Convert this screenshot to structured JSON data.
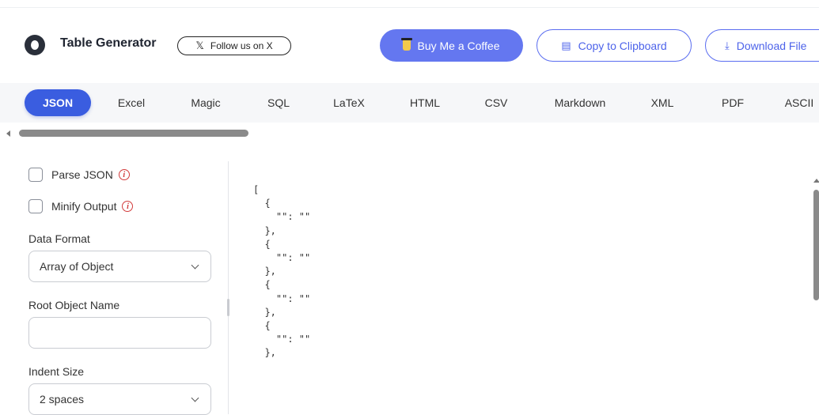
{
  "header": {
    "brand": "Table Generator",
    "follow_label": "Follow us on X",
    "coffee_label": "Buy Me a Coffee",
    "copy_label": "Copy to Clipboard",
    "download_label": "Download File"
  },
  "tabs": [
    {
      "label": "JSON",
      "active": true
    },
    {
      "label": "Excel"
    },
    {
      "label": "Magic"
    },
    {
      "label": "SQL"
    },
    {
      "label": "LaTeX"
    },
    {
      "label": "HTML"
    },
    {
      "label": "CSV"
    },
    {
      "label": "Markdown"
    },
    {
      "label": "XML"
    },
    {
      "label": "PDF"
    },
    {
      "label": "ASCII"
    }
  ],
  "options": {
    "parse_json_label": "Parse JSON",
    "minify_label": "Minify Output",
    "data_format_label": "Data Format",
    "data_format_value": "Array of Object",
    "root_name_label": "Root Object Name",
    "root_name_value": "",
    "indent_label": "Indent Size",
    "indent_value": "2 spaces"
  },
  "output": {
    "code": "[\n  {\n    \"\": \"\"\n  },\n  {\n    \"\": \"\"\n  },\n  {\n    \"\": \"\"\n  },\n  {\n    \"\": \"\"\n  },"
  },
  "colors": {
    "accent": "#3a5de0",
    "coffee_button": "#6477f0",
    "outline_button": "#4d63ea",
    "info_icon": "#d23b3b"
  }
}
